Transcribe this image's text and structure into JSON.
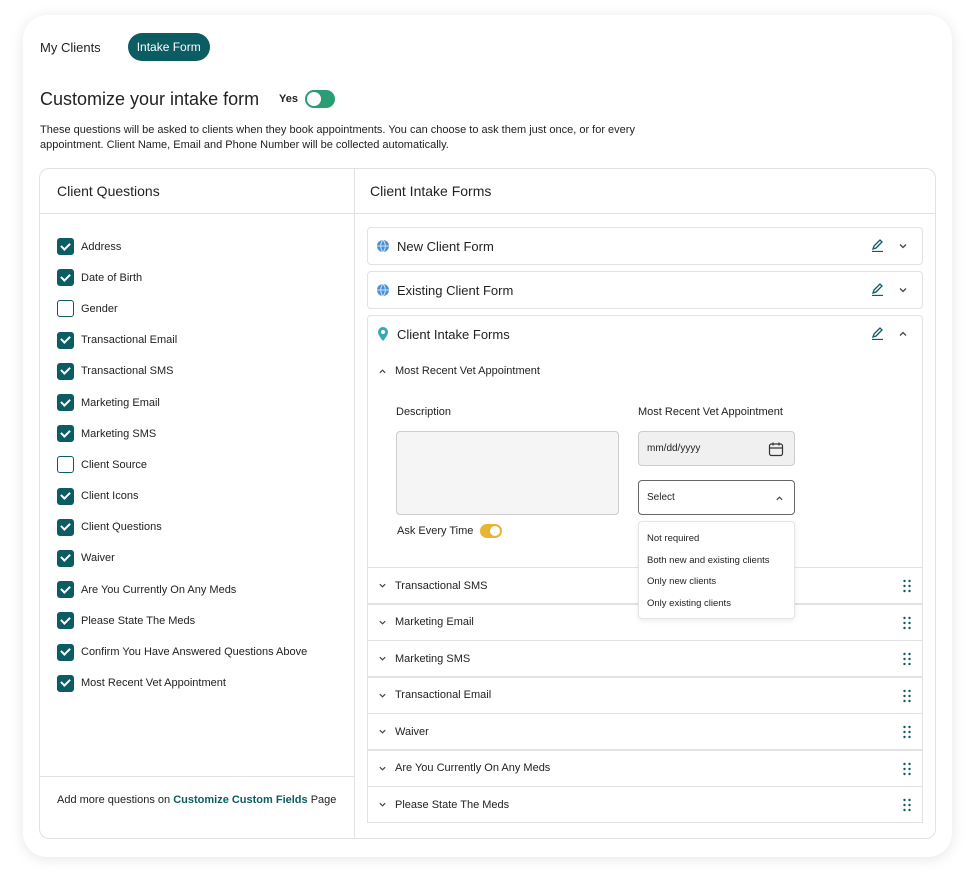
{
  "nav": {
    "my_clients": "My Clients",
    "intake_form": "Intake Form"
  },
  "header": {
    "title": "Customize your intake form",
    "toggle_label": "Yes",
    "description": "These questions will be asked to clients when they book appointments. You can choose to ask them just once, or for every appointment. Client Name, Email and Phone Number will be collected automatically."
  },
  "left": {
    "title": "Client Questions",
    "items": [
      {
        "label": "Address",
        "checked": true
      },
      {
        "label": "Date of Birth",
        "checked": true
      },
      {
        "label": "Gender",
        "checked": false
      },
      {
        "label": "Transactional Email",
        "checked": true
      },
      {
        "label": "Transactional SMS",
        "checked": true
      },
      {
        "label": "Marketing Email",
        "checked": true
      },
      {
        "label": "Marketing SMS",
        "checked": true
      },
      {
        "label": "Client Source",
        "checked": false
      },
      {
        "label": "Client Icons",
        "checked": true
      },
      {
        "label": "Client Questions",
        "checked": true
      },
      {
        "label": "Waiver",
        "checked": true
      },
      {
        "label": "Are You Currently On Any Meds",
        "checked": true
      },
      {
        "label": "Please State The Meds",
        "checked": true
      },
      {
        "label": "Confirm You Have Answered Questions Above",
        "checked": true
      },
      {
        "label": "Most Recent Vet Appointment",
        "checked": true
      }
    ],
    "footer_prefix": "Add more questions on ",
    "footer_link": "Customize Custom Fields",
    "footer_suffix": " Page"
  },
  "right": {
    "title": "Client Intake Forms",
    "forms": [
      {
        "title": "New Client Form",
        "icon": "globe-icon"
      },
      {
        "title": "Existing Client Form",
        "icon": "globe-icon"
      },
      {
        "title": "Client Intake Forms",
        "icon": "location-pin-icon"
      }
    ],
    "expanded": {
      "title": "Most Recent Vet Appointment",
      "description_label": "Description",
      "date_label": "Most Recent Vet Appointment",
      "date_placeholder": "mm/dd/yyyy",
      "select_value": "Select",
      "ask_label": "Ask Every Time",
      "options": [
        "Not required",
        "Both new and existing clients",
        "Only new clients",
        "Only existing clients"
      ]
    },
    "rows": [
      "Transactional SMS",
      "Marketing Email",
      "Marketing SMS",
      "Transactional Email",
      "Waiver",
      "Are You Currently On Any Meds",
      "Please State The Meds"
    ]
  },
  "colors": {
    "primary": "#0c5c63",
    "toggle_on": "#2a9d74",
    "toggle_yellow": "#e7b533",
    "icon_blue": "#4a90d9"
  }
}
